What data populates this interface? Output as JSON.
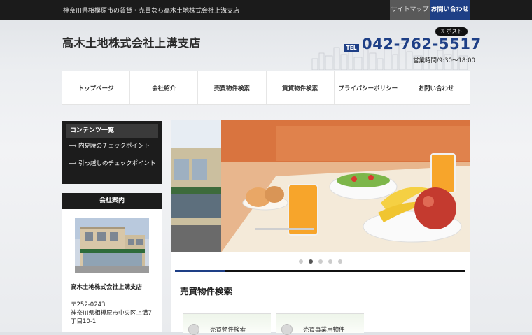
{
  "topbar": {
    "tagline": "神奈川県相模原市の賃貸・売買なら高木土地株式会社上溝支店",
    "sitemap": "サイトマップ",
    "contact": "お問い合わせ"
  },
  "header": {
    "company_name": "高木土地株式会社上溝支店",
    "x_post": "𝕏 ポスト",
    "tel_label": "TEL",
    "tel_number": "042-762-5517",
    "hours": "営業時間/9:30〜18:00"
  },
  "nav": [
    "トップページ",
    "会社紹介",
    "売買物件検索",
    "賃貸物件検索",
    "プライバシーポリシー",
    "お問い合わせ"
  ],
  "sidebar": {
    "contents_title": "コンテンツ一覧",
    "links": [
      "内見時のチェックポイント",
      "引っ越しのチェックポイント"
    ],
    "company_title": "会社案内",
    "company_name": "高木土地株式会社上溝支店",
    "zip": "〒252-0243",
    "address": "神奈川県相模原市中央区上溝7丁目10-1"
  },
  "main": {
    "slider_active_index": 1,
    "slider_count": 5,
    "slider_progress": 0.17,
    "section_title": "売買物件検索",
    "cards": [
      "売買物件検索",
      "売買事業用物件"
    ]
  },
  "colors": {
    "brand_blue": "#1e3f86",
    "dark": "#1c1c1c"
  }
}
